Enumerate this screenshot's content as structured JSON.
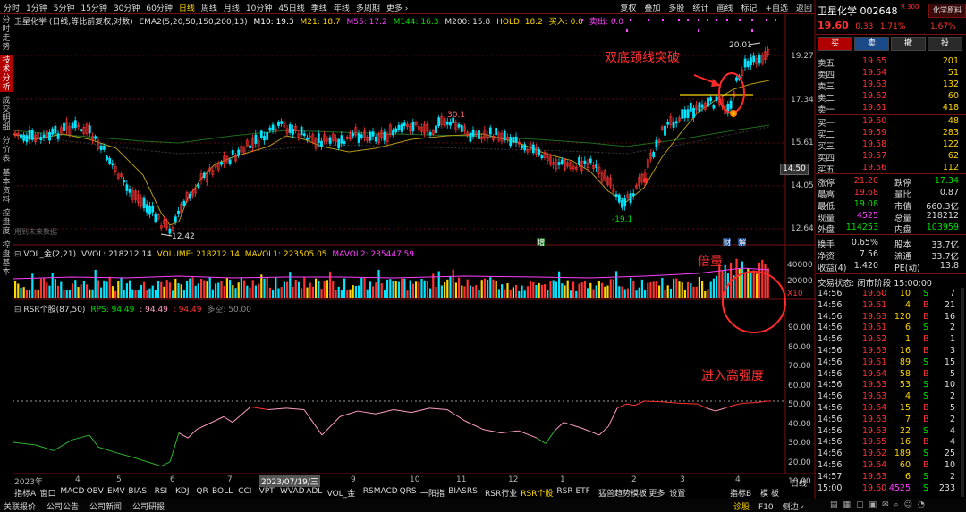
{
  "periods": [
    "分时",
    "1分钟",
    "5分钟",
    "15分钟",
    "30分钟",
    "60分钟",
    "日线",
    "周线",
    "月线",
    "10分钟",
    "45日线",
    "季线",
    "年线",
    "多周期",
    "更多 ›"
  ],
  "active_period": "日线",
  "top_right_tools": [
    "复权",
    "叠加",
    "多股",
    "统计",
    "画线",
    "标记",
    "+自选",
    "返回"
  ],
  "stock": {
    "name": "卫星化学",
    "code": "002648",
    "tag": "R 300",
    "price": "19.60",
    "change": "0.33",
    "pct": "1.71%",
    "tool_btn": "化学原料",
    "tool_pct": "1.67%"
  },
  "chart_header": {
    "title": "卫星化学 (日线,等比前复权,对数)",
    "ema": "EMA2(5,20,50,150,200,13)",
    "m10": "M10: 19.3",
    "m21": "M21: 18.7",
    "m55": "M55: 17.2",
    "m144": "M144: 16.3",
    "m200": "M200: 15.8",
    "hold": "HOLD: 18.2",
    "buy": "买入: 0.0",
    "sell": "卖出: 0.0"
  },
  "left_tabs": [
    "分时走势",
    "技术分析",
    "成交明细",
    "分价表",
    "基本资料",
    "控盘度",
    "控盘基本"
  ],
  "active_left_tab": "技术分析",
  "annotations": {
    "breakout": "双底颈线突破",
    "volume": "倍量",
    "strength": "进入高强度"
  },
  "price_marks": {
    "high": "20.01",
    "p30": "30.1",
    "low1": "12.42",
    "low2": "-19.1",
    "price_tag": "14.50"
  },
  "price_yaxis": [
    "19.27",
    "17.34",
    "15.61",
    "14.05",
    "12.64"
  ],
  "future_text": "用到未来数据",
  "event_marks": [
    "增",
    "财",
    "解"
  ],
  "vol_header": {
    "name": "VOL_金(2,21)",
    "vvol": "VVOL: 218212.14",
    "volume": "VOLUME: 218212.14",
    "mavol1": "MAVOL1: 223505.05",
    "mavol2": "MAVOL2: 235447.59"
  },
  "vol_yaxis": [
    "40000",
    "20000",
    "X10"
  ],
  "rsr_header": {
    "name": "RSR个股(87,50)",
    "rps": "RPS: 94.49",
    "v2": ": 94.49",
    "v3": ": 94.49",
    "v4": "多空: 50.00"
  },
  "rsr_yaxis": [
    "90.00",
    "80.00",
    "70.00",
    "60.00",
    "50.00",
    "40.00",
    "30.00",
    "20.00",
    "10.00"
  ],
  "x_labels": [
    "2023年",
    "4",
    "5",
    "6",
    "7",
    "2023/07/19/三",
    "9",
    "10",
    "11",
    "12",
    "1",
    "2",
    "3",
    "4"
  ],
  "indicator_tabs": [
    "指标A",
    "窗口",
    "MACD",
    "OBV",
    "EMV",
    "BIAS",
    "RSI",
    "KDJ",
    "QR",
    "BOLL",
    "CCI",
    "VPT",
    "WVAD",
    "ADL",
    "VOL_金",
    "RSMACD",
    "QRS",
    "一阳指",
    "BIASRS",
    "RSR行业",
    "RSR个股",
    "RSR ETF",
    "猛兽趋势模板",
    "更多",
    "设置"
  ],
  "active_indicator": "RSR个股",
  "indicator_right": [
    "指标B",
    "模",
    "板"
  ],
  "bottom_links": [
    "关联报价",
    "公司公告",
    "公司新闻",
    "公司研报"
  ],
  "bottom_right": [
    "诊股",
    "F10",
    "侧边 ‹"
  ],
  "daily_label": "日线",
  "order_book": {
    "asks": [
      [
        "卖五",
        "19.65",
        "201"
      ],
      [
        "卖四",
        "19.64",
        "51"
      ],
      [
        "卖三",
        "19.63",
        "132"
      ],
      [
        "卖二",
        "19.62",
        "60"
      ],
      [
        "卖一",
        "19.61",
        "418"
      ]
    ],
    "bids": [
      [
        "买一",
        "19.60",
        "48"
      ],
      [
        "买二",
        "19.59",
        "283"
      ],
      [
        "买三",
        "19.58",
        "122"
      ],
      [
        "买四",
        "19.57",
        "62"
      ],
      [
        "买五",
        "19.56",
        "112"
      ]
    ]
  },
  "trade_buttons": [
    "买",
    "卖",
    "撤",
    "投"
  ],
  "stats": [
    [
      "涨停",
      "21.20",
      "跌停",
      "17.34"
    ],
    [
      "最高",
      "19.68",
      "量比",
      "0.87"
    ],
    [
      "最低",
      "19.08",
      "市值",
      "660.3亿"
    ],
    [
      "现量",
      "4525",
      "总量",
      "218212"
    ],
    [
      "外盘",
      "114253",
      "内盘",
      "103959"
    ],
    [
      "换手",
      "0.65%",
      "股本",
      "33.7亿"
    ],
    [
      "净资",
      "7.56",
      "流通",
      "33.7亿"
    ],
    [
      "收益(4)",
      "1.420",
      "PE(动)",
      "13.8"
    ]
  ],
  "trade_status": "交易状态: 闭市阶段 15:00:00",
  "ticks": [
    [
      "14:56",
      "19.60",
      "10",
      "S",
      "7"
    ],
    [
      "14:56",
      "19.61",
      "4",
      "B",
      "21"
    ],
    [
      "14:56",
      "19.63",
      "120",
      "B",
      "16"
    ],
    [
      "14:56",
      "19.61",
      "6",
      "S",
      "2"
    ],
    [
      "14:56",
      "19.62",
      "1",
      "B",
      "1"
    ],
    [
      "14:56",
      "19.63",
      "16",
      "B",
      "3"
    ],
    [
      "14:56",
      "19.61",
      "89",
      "S",
      "15"
    ],
    [
      "14:56",
      "19.64",
      "58",
      "B",
      "5"
    ],
    [
      "14:56",
      "19.63",
      "53",
      "S",
      "10"
    ],
    [
      "14:56",
      "19.63",
      "4",
      "S",
      "2"
    ],
    [
      "14:56",
      "19.64",
      "15",
      "B",
      "5"
    ],
    [
      "14:56",
      "19.63",
      "7",
      "B",
      "2"
    ],
    [
      "14:56",
      "19.63",
      "22",
      "S",
      "4"
    ],
    [
      "14:56",
      "19.65",
      "16",
      "B",
      "4"
    ],
    [
      "14:56",
      "19.62",
      "189",
      "S",
      "25"
    ],
    [
      "14:56",
      "19.64",
      "60",
      "B",
      "10"
    ],
    [
      "14:57",
      "19.63",
      "6",
      "S",
      "2"
    ],
    [
      "15:00",
      "19.60",
      "4525",
      "S",
      "233"
    ]
  ],
  "colors": {
    "red": "#ff3333",
    "green": "#00e000",
    "cyan": "#00e5ff",
    "yellow": "#ffd700",
    "magenta": "#ff40ff",
    "pink": "#ff9ec4",
    "bg": "#000000",
    "panel_red": "#b00000"
  }
}
